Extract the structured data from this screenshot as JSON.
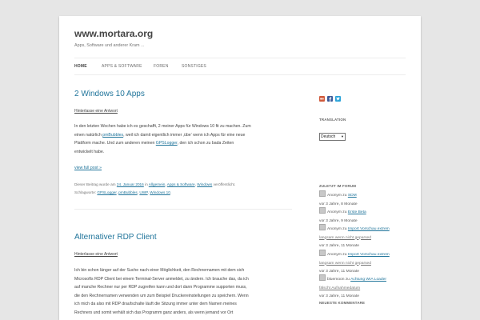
{
  "site": {
    "title": "www.mortara.org",
    "description": "Apps, Software und anderer Kram ..."
  },
  "nav": {
    "items": [
      {
        "label": "HOME",
        "current": true
      },
      {
        "label": "APPS & SOFTWARE"
      },
      {
        "label": "FOREN"
      },
      {
        "label": "SONSTIGES"
      }
    ]
  },
  "posts": [
    {
      "title": "2 Windows 10 Apps",
      "comment_link": "Hinterlasse eine Antwort",
      "body": {
        "l1": "In den letzten Wochen habe ich es geschafft, 2 meiner Apps für Windows 10 fit zu machen. Zum",
        "l2_pre": "einen natürlich ",
        "l2_link": "pmBubbles",
        "l2_post": ", weil ich damit eigentlich immer ‚übe‘ wenn ich Apps für eine neue",
        "l3_pre": "Plattform mache. Und zum anderen meinen ",
        "l3_link": "GPSLogger",
        "l3_post": ", den ich schon zu bada Zeiten",
        "l4": "entwickelt habe."
      },
      "view_full": "view full post »",
      "meta": {
        "prefix": "Dieser Beitrag wurde am ",
        "date": "24. Januar 2016",
        "in": " in ",
        "cat1": "Allgemein",
        "sep1": ", ",
        "cat2": "Apps & Software",
        "sep2": ", ",
        "cat3": "Windows",
        "suffix": " veröffentlicht.",
        "tags_label": "Schlagworte: ",
        "tag1": "GPSLogger",
        "tag2": "pmBubbles",
        "tag3": "UWP",
        "tag4": "Windows 10",
        "tag_sep": ", ",
        "end": "."
      }
    },
    {
      "title": "Alternativer RDP Client",
      "comment_link": "Hinterlasse eine Antwort",
      "body": {
        "l1": "Ich bin schon länger auf der Suche nach einer Möglichkeit, den Rechnernamen mit dem sich",
        "l2": "Microsofts RDP Client bei einem Terminal-Server anmeldet, zu ändern. Ich brauche das, da ich",
        "l3": "auf manche Rechner nur per RDP zugreifen kann und dort dann Programme supporten muss,",
        "l4": "die den Rechnernamen verwenden um zum Beispiel Druckereinstellungen zu speichern. Wenn",
        "l5": "ich mich da also mit RDP draufschalte läuft die Sitzung immer unter dem Namen meines",
        "l6": "Rechners und somit verhält sich das Programm ganz anders, als wenn jemand vor Ort"
      }
    }
  ],
  "sidebar": {
    "social_icons": [
      {
        "name": "flickr",
        "color": "#d05a3c"
      },
      {
        "name": "facebook",
        "color": "#3b5998"
      },
      {
        "name": "twitter",
        "color": "#2aa3d9"
      }
    ],
    "translation_title": "TRANSLATION",
    "language_selected": "Deutsch",
    "forum_title": "ZULETZT IM FORUM",
    "forum_entries": [
      {
        "author": "Anonym",
        "on": " zu ",
        "topic": "SDM",
        "time": "vor 3 Jahre, 8 Monate"
      },
      {
        "author": "Anonym",
        "on": " zu ",
        "topic": "Erste Beta",
        "time": "vor 3 Jahre, 9 Monate"
      },
      {
        "author": "Anonym",
        "on": " zu ",
        "topic_l1": "Import Vorschau extrem",
        "topic_l2": "langsam wenn nicht geparsed",
        "time": "vor 3 Jahre, 11 Monate"
      },
      {
        "author": "Anonym",
        "on": " zu ",
        "topic_l1": "Import Vorschau extrem",
        "topic_l2": "langsam wenn nicht geparsed",
        "time": "vor 3 Jahre, 11 Monate"
      },
      {
        "author": "bluemoon",
        "on": " zu ",
        "topic_l1": "Achtung WIA Loader",
        "topic_l2": "fälscht Aufnahmedatum",
        "time": "vor 3 Jahre, 11 Monate"
      }
    ],
    "comments_title": "NEUESTE KOMMENTARE"
  },
  "colors": {
    "link": "#21759b",
    "background": "#e6e6e6",
    "page": "#ffffff",
    "text": "#444444"
  }
}
